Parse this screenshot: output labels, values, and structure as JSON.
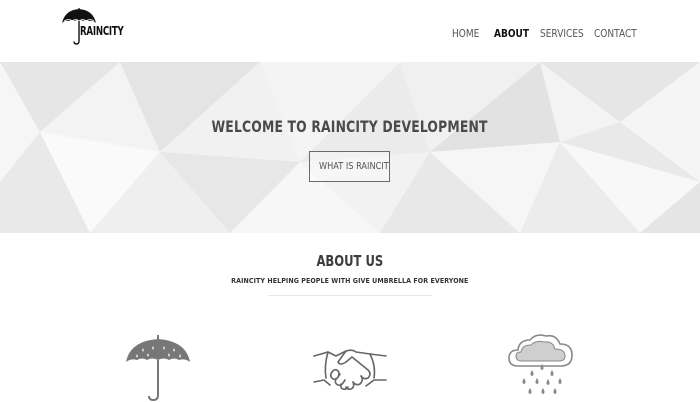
{
  "brand": {
    "name": "RAINCITY",
    "accent_color": "#111111"
  },
  "nav": {
    "items": [
      {
        "label": "HOME",
        "active": false
      },
      {
        "label": "ABOUT",
        "active": true
      },
      {
        "label": "SERVICES",
        "active": false
      },
      {
        "label": "CONTACT",
        "active": false
      }
    ]
  },
  "hero": {
    "title": "WELCOME TO RAINCITY DEVELOPMENT",
    "button_label": "WHAT IS RAINCITY ?"
  },
  "about": {
    "title": "ABOUT US",
    "subtitle": "RAINCITY HELPING PEOPLE WITH GIVE UMBRELLA FOR EVERYONE",
    "features": [
      {
        "icon": "umbrella-icon"
      },
      {
        "icon": "handshake-icon"
      },
      {
        "icon": "rain-cloud-icon"
      }
    ]
  }
}
